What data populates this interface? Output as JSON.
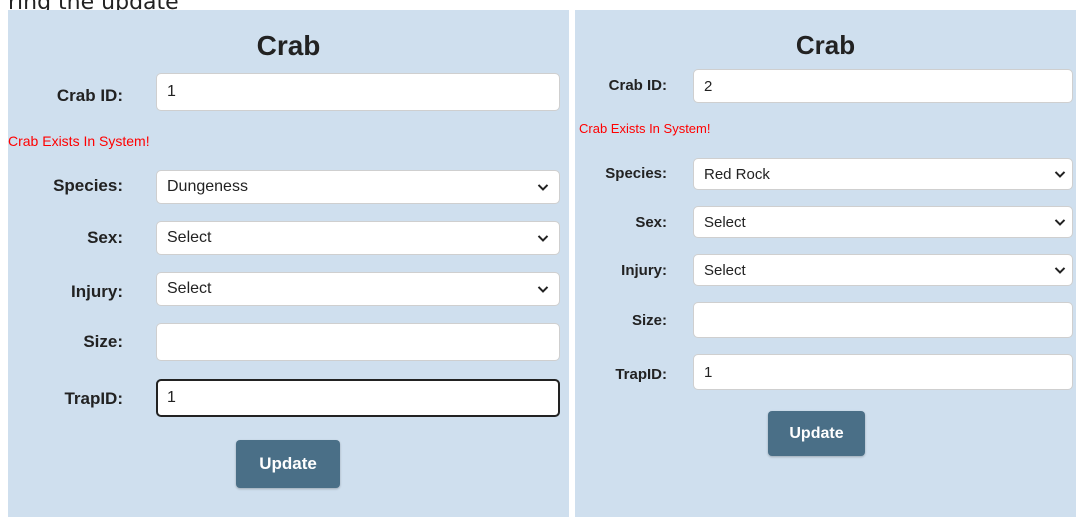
{
  "caption": "ring the update",
  "colors": {
    "panel_bg": "#cfdfee",
    "button_bg": "#4a6f87",
    "notice_text": "#ff0000"
  },
  "panels": [
    {
      "title": "Crab",
      "crab_id_label": "Crab ID:",
      "crab_id_value": "1",
      "notice": "Crab Exists In System!",
      "species_label": "Species:",
      "species_value": "Dungeness",
      "sex_label": "Sex:",
      "sex_value": "Select",
      "injury_label": "Injury:",
      "injury_value": "Select",
      "size_label": "Size:",
      "size_value": "",
      "trap_id_label": "TrapID:",
      "trap_id_value": "1",
      "update_label": "Update"
    },
    {
      "title": "Crab",
      "crab_id_label": "Crab ID:",
      "crab_id_value": "2",
      "notice": "Crab Exists In System!",
      "species_label": "Species:",
      "species_value": "Red Rock",
      "sex_label": "Sex:",
      "sex_value": "Select",
      "injury_label": "Injury:",
      "injury_value": "Select",
      "size_label": "Size:",
      "size_value": "",
      "trap_id_label": "TrapID:",
      "trap_id_value": "1",
      "update_label": "Update"
    }
  ]
}
